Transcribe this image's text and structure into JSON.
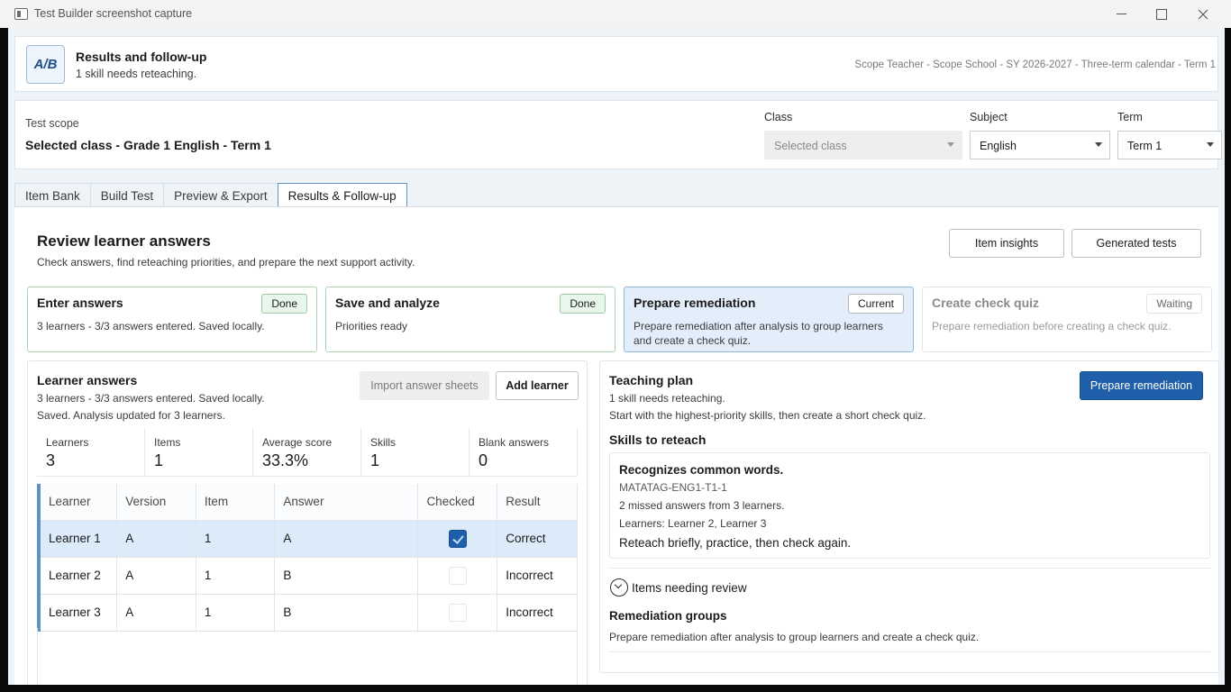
{
  "window": {
    "title": "Test Builder screenshot capture"
  },
  "header": {
    "logo": "A/B",
    "title": "Results and follow-up",
    "subtitle": "1 skill needs reteaching.",
    "context": "Scope Teacher - Scope School - SY 2026-2027 - Three-term calendar - Term 1"
  },
  "scope": {
    "label": "Test scope",
    "value": "Selected class - Grade 1 English - Term 1",
    "class_label": "Class",
    "class_value": "Selected class",
    "subject_label": "Subject",
    "subject_value": "English",
    "term_label": "Term",
    "term_value": "Term 1"
  },
  "tabs": [
    {
      "label": "Item Bank"
    },
    {
      "label": "Build Test"
    },
    {
      "label": "Preview & Export"
    },
    {
      "label": "Results & Follow-up"
    }
  ],
  "review": {
    "title": "Review learner answers",
    "subtitle": "Check answers, find reteaching priorities, and prepare the next support activity.",
    "item_insights_label": "Item insights",
    "generated_tests_label": "Generated tests"
  },
  "steps": [
    {
      "title": "Enter answers",
      "status": "Done",
      "desc": "3 learners - 3/3 answers entered. Saved locally."
    },
    {
      "title": "Save and analyze",
      "status": "Done",
      "desc": "Priorities ready"
    },
    {
      "title": "Prepare remediation",
      "status": "Current",
      "desc": "Prepare remediation after analysis to group learners and create a check quiz."
    },
    {
      "title": "Create check quiz",
      "status": "Waiting",
      "desc": "Prepare remediation before creating a check quiz."
    }
  ],
  "learner_answers": {
    "title": "Learner answers",
    "line1": "3 learners - 3/3 answers entered. Saved locally.",
    "line2": "Saved. Analysis updated for 3 learners.",
    "import_label": "Import answer sheets",
    "add_label": "Add learner",
    "stats": [
      {
        "label": "Learners",
        "value": "3"
      },
      {
        "label": "Items",
        "value": "1"
      },
      {
        "label": "Average score",
        "value": "33.3%"
      },
      {
        "label": "Skills",
        "value": "1"
      },
      {
        "label": "Blank answers",
        "value": "0"
      }
    ],
    "columns": [
      "Learner",
      "Version",
      "Item",
      "Answer",
      "Checked",
      "Result"
    ],
    "rows": [
      {
        "learner": "Learner 1",
        "version": "A",
        "item": "1",
        "answer": "A",
        "checked": true,
        "result": "Correct"
      },
      {
        "learner": "Learner 2",
        "version": "A",
        "item": "1",
        "answer": "B",
        "checked": false,
        "result": "Incorrect"
      },
      {
        "learner": "Learner 3",
        "version": "A",
        "item": "1",
        "answer": "B",
        "checked": false,
        "result": "Incorrect"
      }
    ]
  },
  "teaching_plan": {
    "title": "Teaching plan",
    "line1": "1 skill needs reteaching.",
    "line2": "Start with the highest-priority skills, then create a short check quiz.",
    "prepare_label": "Prepare remediation",
    "skills_heading": "Skills to reteach",
    "skill": {
      "name": "Recognizes common words.",
      "code": "MATATAG-ENG1-T1-1",
      "missed": "2 missed answers from 3 learners.",
      "learners": "Learners: Learner 2, Learner 3",
      "advice": "Reteach briefly, practice, then check again."
    },
    "items_review_label": "Items needing review",
    "groups_heading": "Remediation groups",
    "groups_text": "Prepare remediation after analysis to group learners and create a check quiz."
  }
}
